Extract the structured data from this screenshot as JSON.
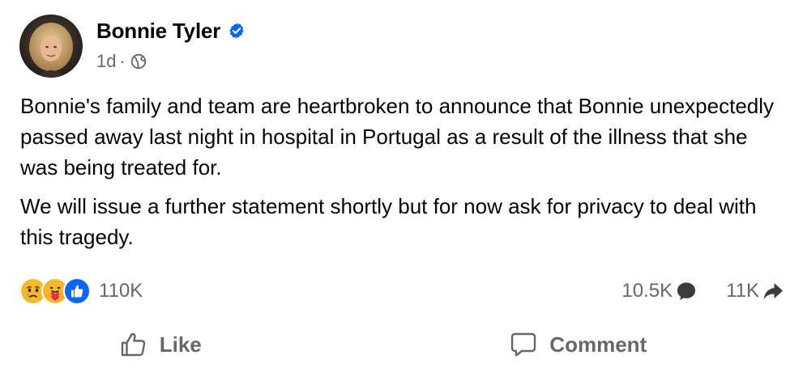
{
  "post": {
    "author": "Bonnie Tyler",
    "timestamp": "1d",
    "separator": "·",
    "privacy_icon": "globe-icon",
    "verified_icon": "verified-badge-icon",
    "body": [
      "Bonnie's family and team are heartbroken to announce that Bonnie unexpectedly passed away last night in hospital in Portugal as a result of the illness that she was being treated for.",
      "We will issue a further statement shortly but for now ask for privacy to deal with this tragedy."
    ]
  },
  "stats": {
    "reaction_icons": [
      "sad-reaction-icon",
      "care-reaction-icon",
      "like-reaction-icon"
    ],
    "reaction_count": "110K",
    "comment_count": "10.5K",
    "share_count": "11K"
  },
  "actions": {
    "like_label": "Like",
    "comment_label": "Comment"
  },
  "colors": {
    "text_primary": "#050505",
    "text_secondary": "#65676b",
    "facebook_blue": "#0866ff",
    "reaction_yellow": "#f7b928"
  }
}
